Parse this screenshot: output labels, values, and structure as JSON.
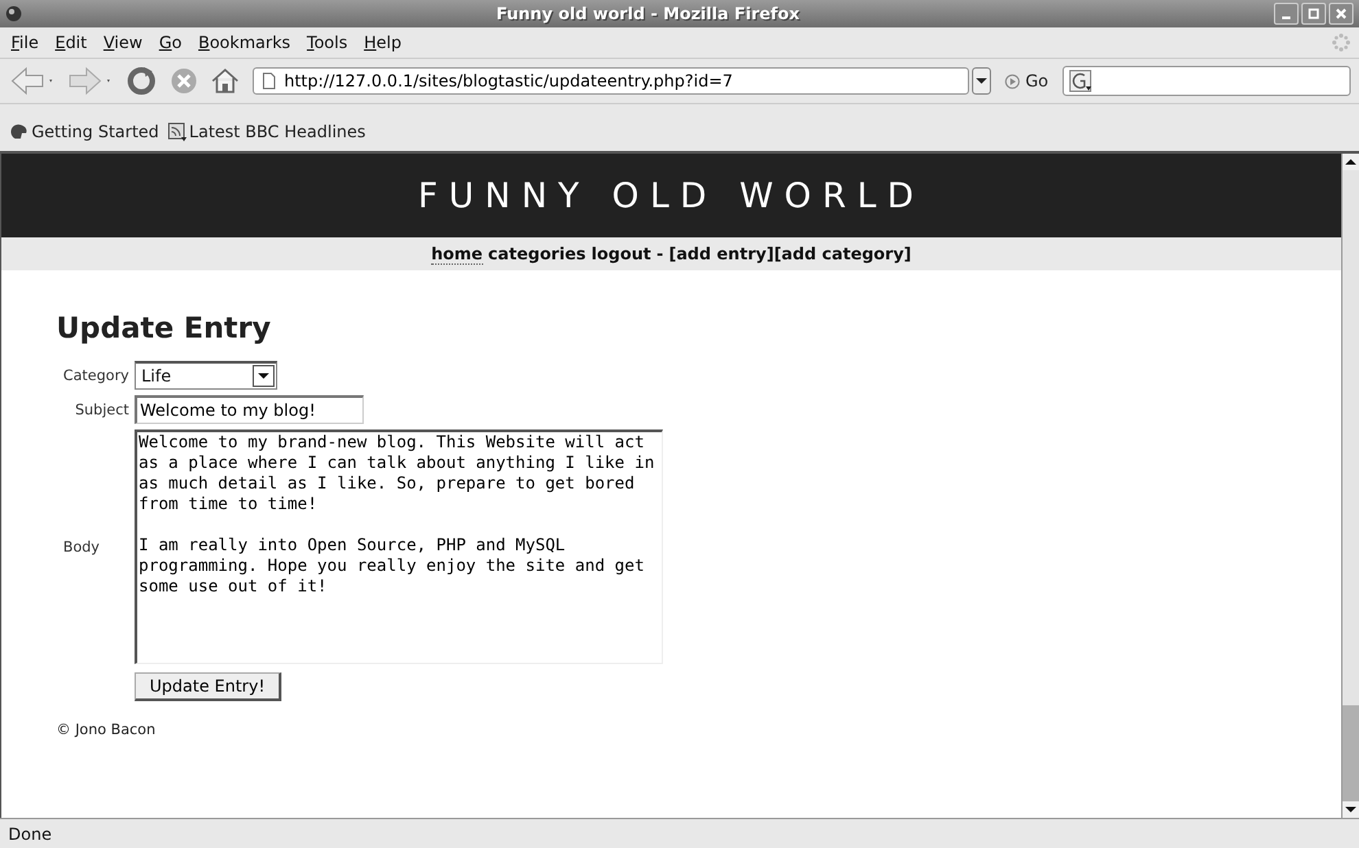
{
  "window": {
    "title": "Funny old world - Mozilla Firefox"
  },
  "menu": [
    "File",
    "Edit",
    "View",
    "Go",
    "Bookmarks",
    "Tools",
    "Help"
  ],
  "address": {
    "value": "http://127.0.0.1/sites/blogtastic/updateentry.php?id=7"
  },
  "go_button": "Go",
  "bookmarks": [
    {
      "label": "Getting Started",
      "kind": "site"
    },
    {
      "label": "Latest BBC Headlines",
      "kind": "feed"
    }
  ],
  "site": {
    "title": "FUNNY OLD WORLD",
    "nav": [
      {
        "label": "home",
        "selected": true
      },
      {
        "label": "categories",
        "selected": false
      },
      {
        "label": "logout",
        "selected": false
      }
    ],
    "separator": "-",
    "admin_links": [
      "[add entry]",
      "[add category]"
    ]
  },
  "form": {
    "heading": "Update Entry",
    "category": {
      "label": "Category",
      "value": "Life"
    },
    "subject": {
      "label": "Subject",
      "value": "Welcome to my blog!"
    },
    "body": {
      "label": "Body",
      "value": "Welcome to my brand-new blog. This Website will act as a place where I can talk about anything I like in as much detail as I like. So, prepare to get bored from time to time!\n\nI am really into Open Source, PHP and MySQL programming. Hope you really enjoy the site and get some use out of it!"
    },
    "submit": "Update Entry!"
  },
  "footer": "© Jono Bacon",
  "status_bar": "Done"
}
